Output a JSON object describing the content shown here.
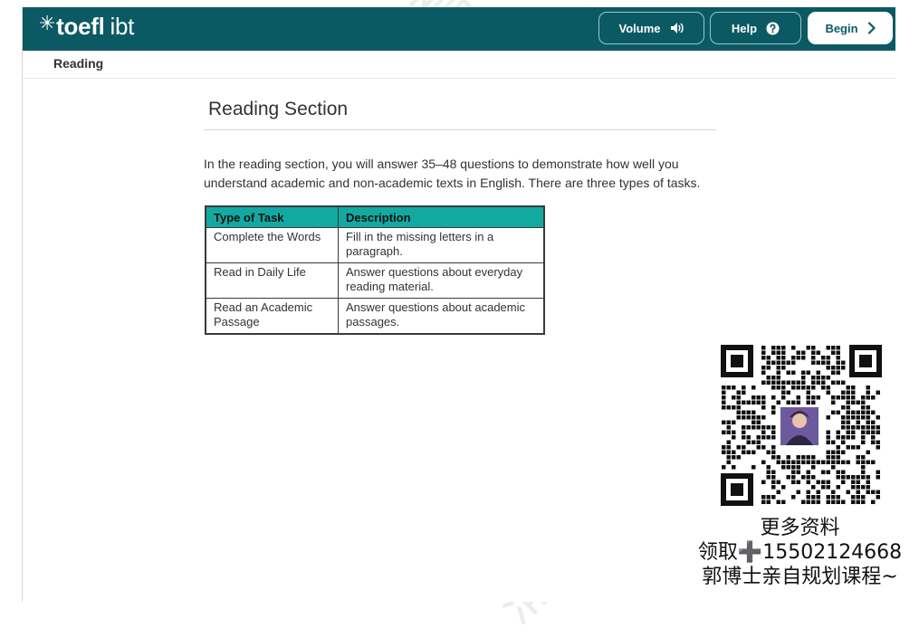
{
  "header": {
    "logo_text": "toefl",
    "logo_suffix": "ibt",
    "volume_label": "Volume",
    "help_label": "Help",
    "begin_label": "Begin"
  },
  "breadcrumb": {
    "label": "Reading"
  },
  "main": {
    "title": "Reading Section",
    "intro": "In the reading section, you will answer 35–48 questions to demonstrate how well you understand academic and non-academic texts in English. There are three types of tasks.",
    "table": {
      "headers": [
        "Type of Task",
        "Description"
      ],
      "rows": [
        [
          "Complete the Words",
          "Fill in the missing letters in a paragraph."
        ],
        [
          "Read in Daily Life",
          "Answer questions about everyday reading material."
        ],
        [
          "Read an Academic Passage",
          "Answer questions about academic passages."
        ]
      ]
    }
  },
  "overlay": {
    "watermark": "蒲公英教育",
    "promo_line1": "更多资料",
    "promo_line2": "领取➕15502124668",
    "promo_line3": "郭博士亲自规划课程~"
  },
  "icons": {
    "volume": "speaker-icon",
    "help": "question-circle-icon",
    "begin": "chevron-right-icon"
  },
  "colors": {
    "topbar": "#0b5a63",
    "table_header": "#12aaa0"
  }
}
